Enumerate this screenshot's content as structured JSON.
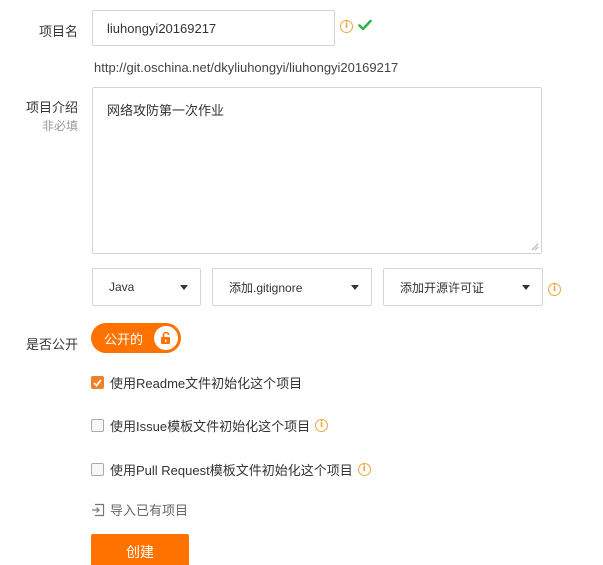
{
  "project_name": {
    "label": "项目名",
    "value": "liuhongyi20169217",
    "url": "http://git.oschina.net/dkyliuhongyi/liuhongyi20169217"
  },
  "project_intro": {
    "label": "项目介绍",
    "sublabel": "非必填",
    "value": "网络攻防第一次作业"
  },
  "selects": {
    "language": "Java",
    "gitignore": "添加.gitignore",
    "license": "添加开源许可证"
  },
  "visibility": {
    "label": "是否公开",
    "toggle_label": "公开的",
    "is_public": true
  },
  "options": [
    {
      "label": "使用Readme文件初始化这个项目",
      "checked": true
    },
    {
      "label": "使用Issue模板文件初始化这个项目",
      "checked": false
    },
    {
      "label": "使用Pull Request模板文件初始化这个项目",
      "checked": false
    }
  ],
  "import_link": "导入已有项目",
  "create_button": "创建",
  "colors": {
    "accent": "#ff7200",
    "info": "#f0a53a",
    "valid": "#2fb54a"
  },
  "icons": {
    "info": "info-icon",
    "valid": "check-icon",
    "import": "import-icon",
    "lock": "unlock-icon"
  }
}
